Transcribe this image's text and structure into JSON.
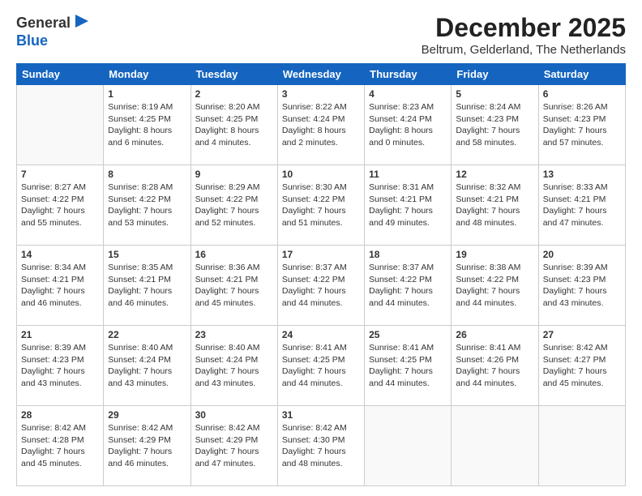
{
  "header": {
    "logo_line1": "General",
    "logo_line2": "Blue",
    "month": "December 2025",
    "location": "Beltrum, Gelderland, The Netherlands"
  },
  "weekdays": [
    "Sunday",
    "Monday",
    "Tuesday",
    "Wednesday",
    "Thursday",
    "Friday",
    "Saturday"
  ],
  "weeks": [
    [
      {
        "day": "",
        "sunrise": "",
        "sunset": "",
        "daylight": "",
        "empty": true
      },
      {
        "day": "1",
        "sunrise": "Sunrise: 8:19 AM",
        "sunset": "Sunset: 4:25 PM",
        "daylight": "Daylight: 8 hours and 6 minutes."
      },
      {
        "day": "2",
        "sunrise": "Sunrise: 8:20 AM",
        "sunset": "Sunset: 4:25 PM",
        "daylight": "Daylight: 8 hours and 4 minutes."
      },
      {
        "day": "3",
        "sunrise": "Sunrise: 8:22 AM",
        "sunset": "Sunset: 4:24 PM",
        "daylight": "Daylight: 8 hours and 2 minutes."
      },
      {
        "day": "4",
        "sunrise": "Sunrise: 8:23 AM",
        "sunset": "Sunset: 4:24 PM",
        "daylight": "Daylight: 8 hours and 0 minutes."
      },
      {
        "day": "5",
        "sunrise": "Sunrise: 8:24 AM",
        "sunset": "Sunset: 4:23 PM",
        "daylight": "Daylight: 7 hours and 58 minutes."
      },
      {
        "day": "6",
        "sunrise": "Sunrise: 8:26 AM",
        "sunset": "Sunset: 4:23 PM",
        "daylight": "Daylight: 7 hours and 57 minutes."
      }
    ],
    [
      {
        "day": "7",
        "sunrise": "Sunrise: 8:27 AM",
        "sunset": "Sunset: 4:22 PM",
        "daylight": "Daylight: 7 hours and 55 minutes."
      },
      {
        "day": "8",
        "sunrise": "Sunrise: 8:28 AM",
        "sunset": "Sunset: 4:22 PM",
        "daylight": "Daylight: 7 hours and 53 minutes."
      },
      {
        "day": "9",
        "sunrise": "Sunrise: 8:29 AM",
        "sunset": "Sunset: 4:22 PM",
        "daylight": "Daylight: 7 hours and 52 minutes."
      },
      {
        "day": "10",
        "sunrise": "Sunrise: 8:30 AM",
        "sunset": "Sunset: 4:22 PM",
        "daylight": "Daylight: 7 hours and 51 minutes."
      },
      {
        "day": "11",
        "sunrise": "Sunrise: 8:31 AM",
        "sunset": "Sunset: 4:21 PM",
        "daylight": "Daylight: 7 hours and 49 minutes."
      },
      {
        "day": "12",
        "sunrise": "Sunrise: 8:32 AM",
        "sunset": "Sunset: 4:21 PM",
        "daylight": "Daylight: 7 hours and 48 minutes."
      },
      {
        "day": "13",
        "sunrise": "Sunrise: 8:33 AM",
        "sunset": "Sunset: 4:21 PM",
        "daylight": "Daylight: 7 hours and 47 minutes."
      }
    ],
    [
      {
        "day": "14",
        "sunrise": "Sunrise: 8:34 AM",
        "sunset": "Sunset: 4:21 PM",
        "daylight": "Daylight: 7 hours and 46 minutes."
      },
      {
        "day": "15",
        "sunrise": "Sunrise: 8:35 AM",
        "sunset": "Sunset: 4:21 PM",
        "daylight": "Daylight: 7 hours and 46 minutes."
      },
      {
        "day": "16",
        "sunrise": "Sunrise: 8:36 AM",
        "sunset": "Sunset: 4:21 PM",
        "daylight": "Daylight: 7 hours and 45 minutes."
      },
      {
        "day": "17",
        "sunrise": "Sunrise: 8:37 AM",
        "sunset": "Sunset: 4:22 PM",
        "daylight": "Daylight: 7 hours and 44 minutes."
      },
      {
        "day": "18",
        "sunrise": "Sunrise: 8:37 AM",
        "sunset": "Sunset: 4:22 PM",
        "daylight": "Daylight: 7 hours and 44 minutes."
      },
      {
        "day": "19",
        "sunrise": "Sunrise: 8:38 AM",
        "sunset": "Sunset: 4:22 PM",
        "daylight": "Daylight: 7 hours and 44 minutes."
      },
      {
        "day": "20",
        "sunrise": "Sunrise: 8:39 AM",
        "sunset": "Sunset: 4:23 PM",
        "daylight": "Daylight: 7 hours and 43 minutes."
      }
    ],
    [
      {
        "day": "21",
        "sunrise": "Sunrise: 8:39 AM",
        "sunset": "Sunset: 4:23 PM",
        "daylight": "Daylight: 7 hours and 43 minutes."
      },
      {
        "day": "22",
        "sunrise": "Sunrise: 8:40 AM",
        "sunset": "Sunset: 4:24 PM",
        "daylight": "Daylight: 7 hours and 43 minutes."
      },
      {
        "day": "23",
        "sunrise": "Sunrise: 8:40 AM",
        "sunset": "Sunset: 4:24 PM",
        "daylight": "Daylight: 7 hours and 43 minutes."
      },
      {
        "day": "24",
        "sunrise": "Sunrise: 8:41 AM",
        "sunset": "Sunset: 4:25 PM",
        "daylight": "Daylight: 7 hours and 44 minutes."
      },
      {
        "day": "25",
        "sunrise": "Sunrise: 8:41 AM",
        "sunset": "Sunset: 4:25 PM",
        "daylight": "Daylight: 7 hours and 44 minutes."
      },
      {
        "day": "26",
        "sunrise": "Sunrise: 8:41 AM",
        "sunset": "Sunset: 4:26 PM",
        "daylight": "Daylight: 7 hours and 44 minutes."
      },
      {
        "day": "27",
        "sunrise": "Sunrise: 8:42 AM",
        "sunset": "Sunset: 4:27 PM",
        "daylight": "Daylight: 7 hours and 45 minutes."
      }
    ],
    [
      {
        "day": "28",
        "sunrise": "Sunrise: 8:42 AM",
        "sunset": "Sunset: 4:28 PM",
        "daylight": "Daylight: 7 hours and 45 minutes."
      },
      {
        "day": "29",
        "sunrise": "Sunrise: 8:42 AM",
        "sunset": "Sunset: 4:29 PM",
        "daylight": "Daylight: 7 hours and 46 minutes."
      },
      {
        "day": "30",
        "sunrise": "Sunrise: 8:42 AM",
        "sunset": "Sunset: 4:29 PM",
        "daylight": "Daylight: 7 hours and 47 minutes."
      },
      {
        "day": "31",
        "sunrise": "Sunrise: 8:42 AM",
        "sunset": "Sunset: 4:30 PM",
        "daylight": "Daylight: 7 hours and 48 minutes."
      },
      {
        "day": "",
        "sunrise": "",
        "sunset": "",
        "daylight": "",
        "empty": true
      },
      {
        "day": "",
        "sunrise": "",
        "sunset": "",
        "daylight": "",
        "empty": true
      },
      {
        "day": "",
        "sunrise": "",
        "sunset": "",
        "daylight": "",
        "empty": true
      }
    ]
  ]
}
